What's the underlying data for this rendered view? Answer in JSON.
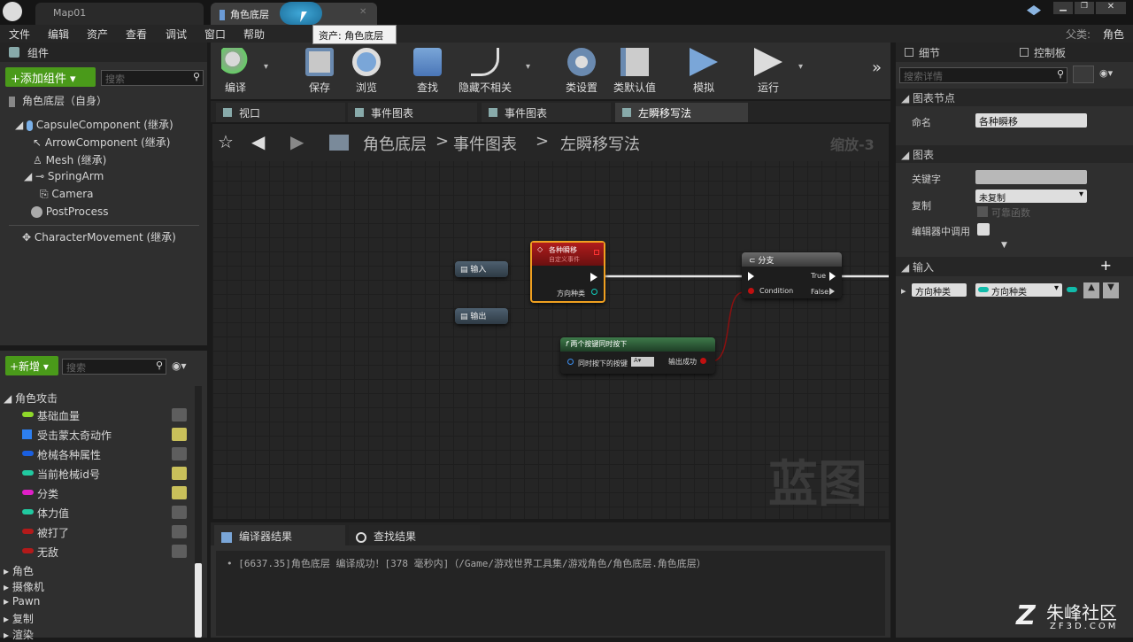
{
  "tabs": {
    "map": "Map01",
    "blueprint": "角色底层",
    "tooltip": "资产: 角色底层",
    "parent_label": "父类:",
    "parent_value": "角色"
  },
  "menu": [
    "文件",
    "编辑",
    "资产",
    "查看",
    "调试",
    "窗口",
    "帮助"
  ],
  "toolbar": [
    {
      "label": "编译",
      "icon": "compile-icon"
    },
    {
      "label": "保存",
      "icon": "save-icon"
    },
    {
      "label": "浏览",
      "icon": "browse-icon"
    },
    {
      "label": "查找",
      "icon": "find-icon"
    },
    {
      "label": "隐藏不相关",
      "icon": "hide-unrelated-icon"
    },
    {
      "label": "类设置",
      "icon": "class-settings-icon"
    },
    {
      "label": "类默认值",
      "icon": "class-defaults-icon"
    },
    {
      "label": "模拟",
      "icon": "simulate-icon"
    },
    {
      "label": "运行",
      "icon": "play-icon"
    }
  ],
  "components": {
    "title": "组件",
    "add_button": "+添加组件 ▾",
    "search_placeholder": "搜索",
    "root": "角色底层（自身）",
    "items": [
      "CapsuleComponent (继承)",
      "ArrowComponent (继承)",
      "Mesh (继承)",
      "SpringArm",
      "Camera",
      "PostProcess",
      "CharacterMovement (继承)"
    ]
  },
  "mybp": {
    "new_button": "+新增 ▾",
    "search_placeholder": "搜索",
    "category": "角色攻击",
    "vars": [
      {
        "name": "基础血量",
        "color": "#8fd82a",
        "eye": false
      },
      {
        "name": "受击蒙太奇动作",
        "color": "#2d7ff0",
        "eye": true
      },
      {
        "name": "枪械各种属性",
        "color": "#1a5fe0",
        "eye": false
      },
      {
        "name": "当前枪械id号",
        "color": "#21c9a0",
        "eye": true
      },
      {
        "name": "分类",
        "color": "#e01fc8",
        "eye": true
      },
      {
        "name": "体力值",
        "color": "#21c9a0",
        "eye": false
      },
      {
        "name": "被打了",
        "color": "#b31a1a",
        "eye": false
      },
      {
        "name": "无敌",
        "color": "#b31a1a",
        "eye": false
      }
    ],
    "cats": [
      "角色",
      "摄像机",
      "Pawn",
      "复制",
      "渲染"
    ]
  },
  "graph_tabs": [
    "视口",
    "事件图表",
    "事件图表",
    "左瞬移写法"
  ],
  "breadcrumb": {
    "root": "角色底层",
    "sep1": ">",
    "mid": "事件图表",
    "sep2": ">",
    "leaf": "左瞬移写法",
    "zoom": "缩放-3"
  },
  "nodes": {
    "input": "输入",
    "output": "输出",
    "event_title": "各种瞬移",
    "event_sub": "自定义事件",
    "event_pin": "方向种类",
    "branch": "分支",
    "true": "True",
    "false": "False",
    "condition": "Condition",
    "func_title": "两个按键同时按下",
    "func_in": "同时按下的按键",
    "func_in_val": "A",
    "func_out": "输出成功"
  },
  "watermark": "蓝图",
  "bottom": {
    "tab1": "编译器结果",
    "tab2": "查找结果",
    "log": "[6637.35]角色底层 编译成功！[378 毫秒内]（/Game/游戏世界工具集/游戏角色/角色底层.角色底层）"
  },
  "details": {
    "tab1": "细节",
    "tab2": "控制板",
    "search_placeholder": "搜索详情",
    "sec1": "图表节点",
    "name_label": "命名",
    "name_value": "各种瞬移",
    "sec2": "图表",
    "kw_label": "关键字",
    "kw_value": "",
    "rep_label": "复制",
    "rep_value": "未复制",
    "reliable": "可靠函数",
    "editor_call": "编辑器中调用",
    "sec3": "输入",
    "input_name": "方向种类",
    "input_type": "方向种类"
  },
  "site": {
    "name": "朱峰社区",
    "url": "ZF3D.COM"
  }
}
